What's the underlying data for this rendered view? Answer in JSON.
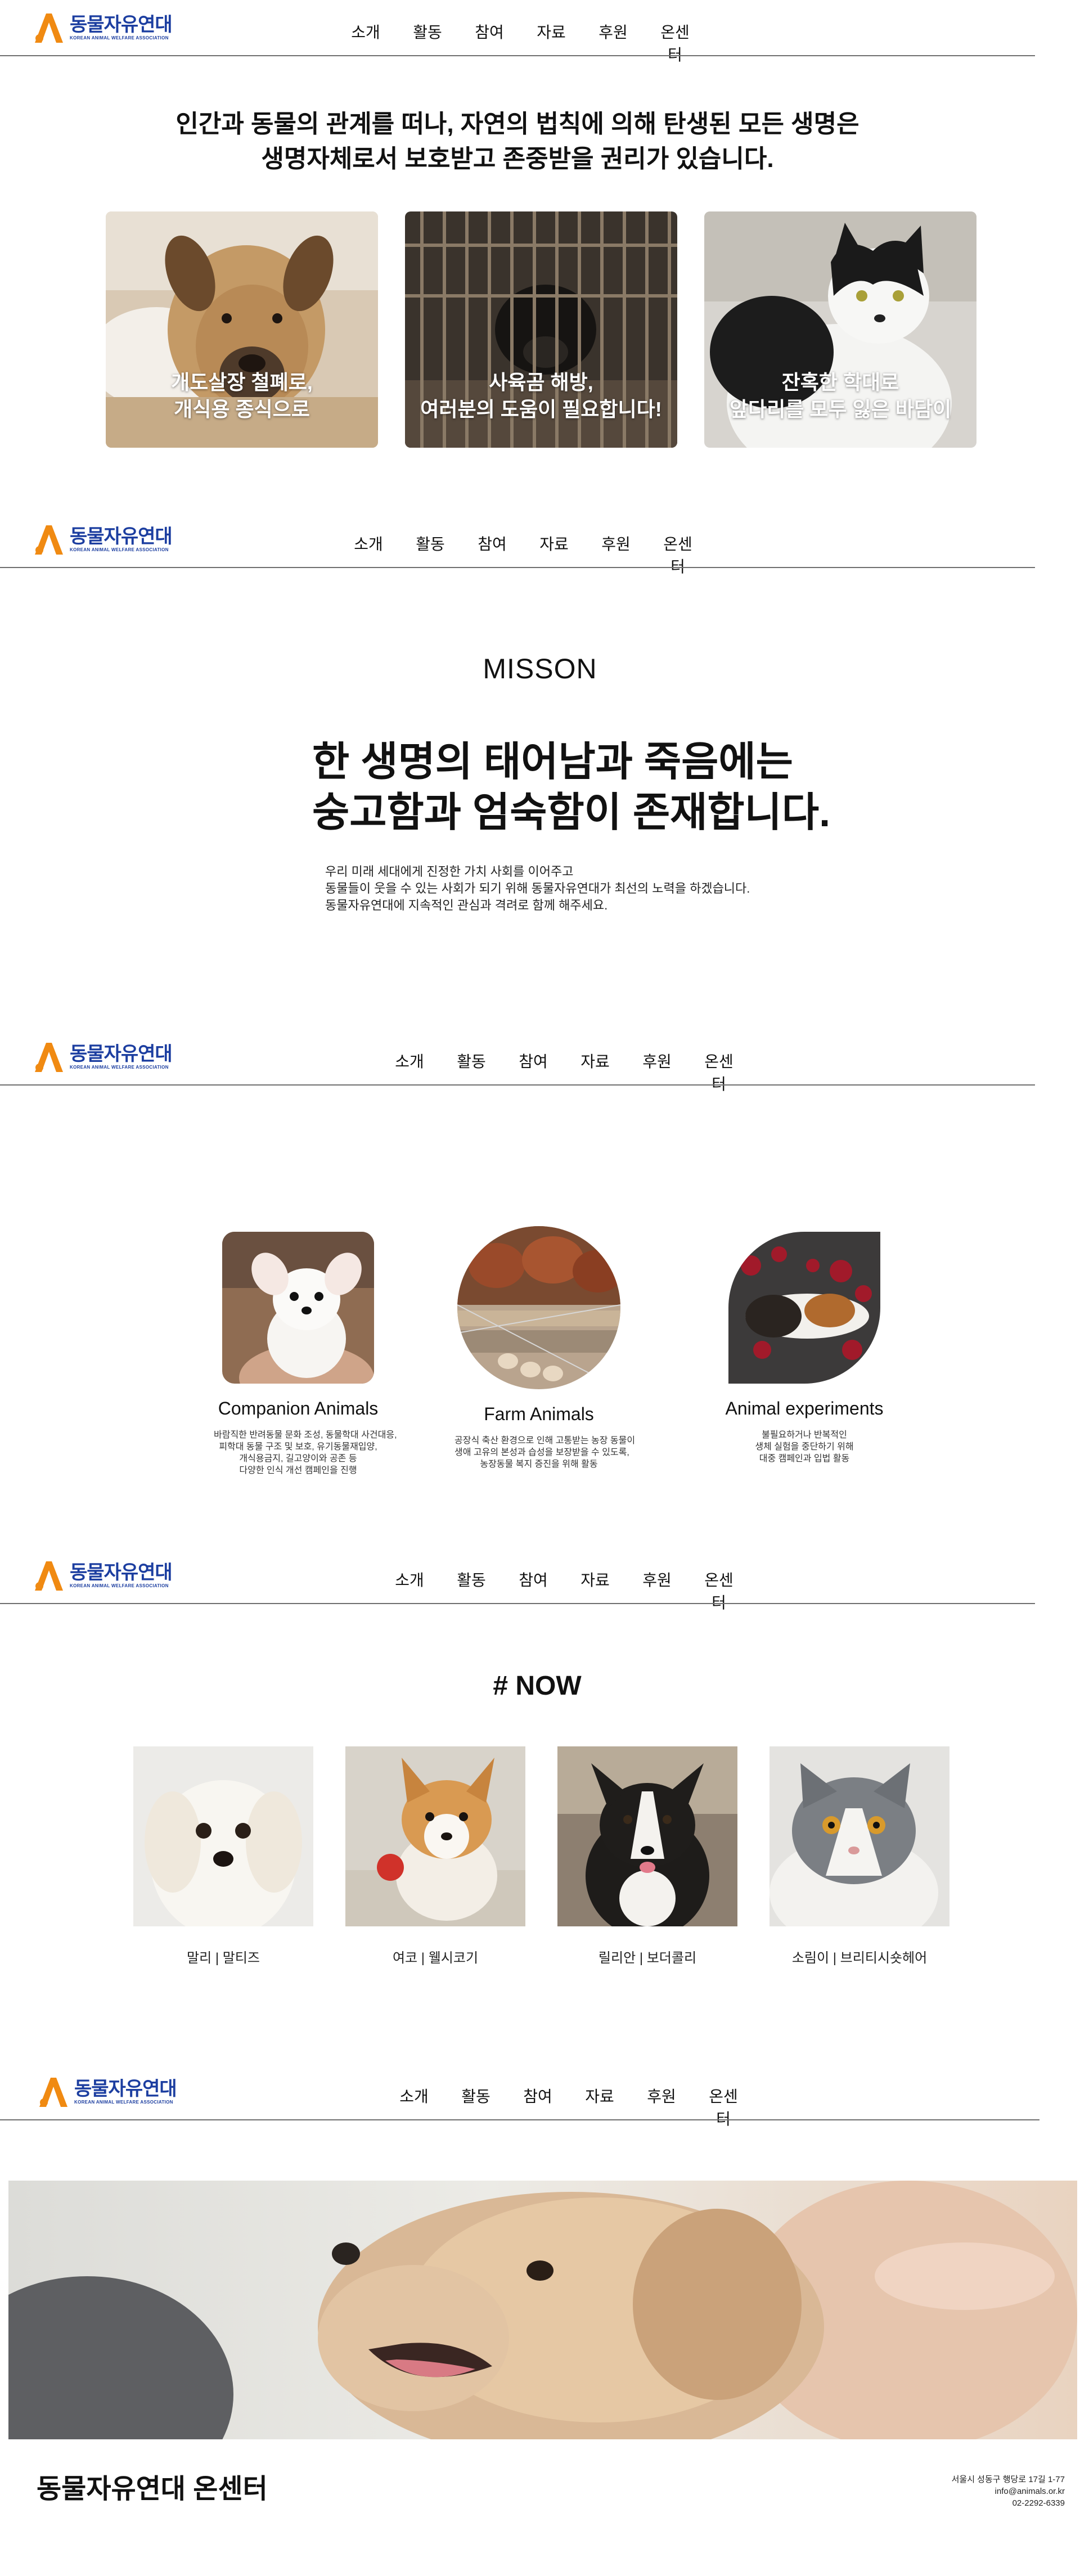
{
  "brand": {
    "name": "동물자유연대",
    "sub": "KOREAN ANIMAL WELFARE ASSOCIATION",
    "colors": {
      "blue": "#1c3ea0",
      "orange": "#f08a12"
    }
  },
  "nav": {
    "items": [
      "소개",
      "활동",
      "참여",
      "자료",
      "후원",
      "온센터"
    ]
  },
  "section1": {
    "title_lines": [
      "인간과 동물의 관계를 떠나, 자연의 법칙에 의해 탄생된 모든 생명은",
      "생명자체로서 보호받고 존중받을 권리가 있습니다."
    ],
    "cards": [
      {
        "lines": [
          "개도살장 철폐로,",
          "개식용 종식으로"
        ],
        "image": "sad-dog-photo"
      },
      {
        "lines": [
          "사육곰 해방,",
          "여러분의 도움이 필요합니다!"
        ],
        "image": "caged-bear-photo"
      },
      {
        "lines": [
          "잔혹한 학대로",
          "앞다리를 모두 잃은 바담이"
        ],
        "image": "black-white-cat-photo"
      }
    ]
  },
  "section2": {
    "heading": "MISSON",
    "quote_lines": [
      "한 생명의 태어남과 죽음에는",
      "숭고함과 엄숙함이 존재합니다."
    ],
    "body_lines": [
      "우리 미래 세대에게 진정한 가치 사회를 이어주고",
      "동물들이 웃을 수 있는 사회가 되기 위해 동물자유연대가 최선의 노력을 하겠습니다.",
      "동물자유연대에 지속적인 관심과 격려로 함께 해주세요."
    ]
  },
  "section3": {
    "categories": [
      {
        "title": "Companion Animals",
        "desc_lines": [
          "바람직한 반려동물 문화 조성, 동물학대 사건대응,",
          "피학대 동물 구조 및 보호, 유기동물재입양,",
          "개식용금지, 길고양이와 공존 등",
          "다양한 인식 개선 캠페인을 진행"
        ],
        "image": "white-puppy-photo"
      },
      {
        "title": "Farm Animals",
        "desc_lines": [
          "공장식 축산 환경으로 인해 고통받는 농장 동물이",
          "생애 고유의 본성과 습성을 보장받을 수 있도록,",
          "농장동물 복지 증진을 위해 활동"
        ],
        "image": "hens-in-cage-photo"
      },
      {
        "title": "Animal experiments",
        "desc_lines": [
          "불필요하거나 반복적인",
          "생체 실험을 중단하기 위해",
          "대중 캠페인과 입법 활동"
        ],
        "image": "beagle-sleeping-photo"
      }
    ]
  },
  "section4": {
    "title": "# NOW",
    "pets": [
      {
        "caption": "말리 | 말티즈",
        "image": "maltese-photo"
      },
      {
        "caption": "여코 | 웰시코기",
        "image": "corgi-photo"
      },
      {
        "caption": "릴리안 | 보더콜리",
        "image": "border-collie-photo"
      },
      {
        "caption": "소림이 | 브리티시숏헤어",
        "image": "british-shorthair-photo"
      }
    ]
  },
  "section5": {
    "hero_image": "golden-retriever-photo",
    "footer_title": "동물자유연대 온센터",
    "info_lines": [
      "서울시 성동구 행당로 17길 1-77",
      "info@animals.or.kr",
      "02-2292-6339"
    ]
  }
}
